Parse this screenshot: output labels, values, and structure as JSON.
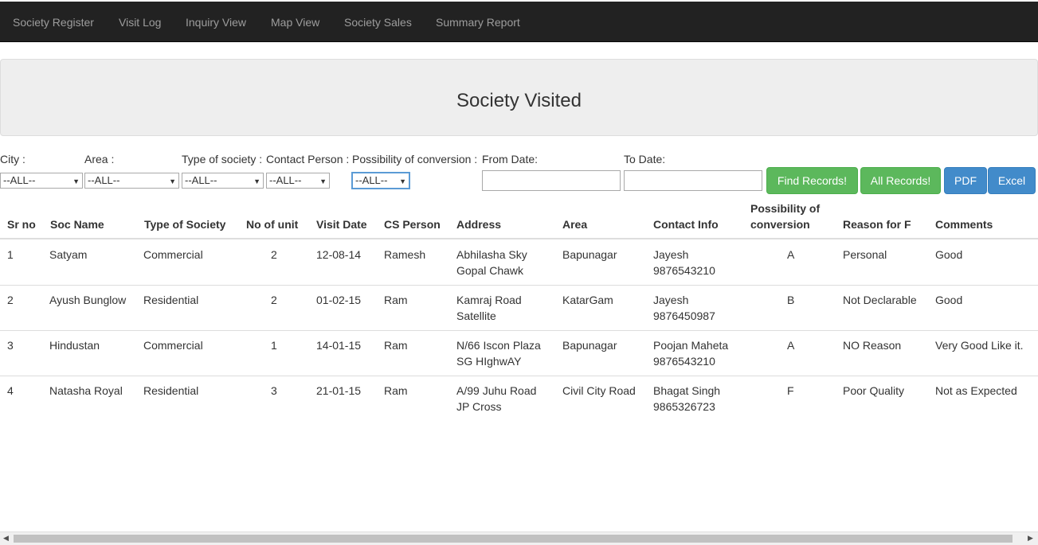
{
  "nav": {
    "items": [
      "Society Register",
      "Visit Log",
      "Inquiry View",
      "Map View",
      "Society Sales",
      "Summary Report"
    ]
  },
  "page": {
    "title": "Society Visited"
  },
  "filters": {
    "city_label": "City :",
    "area_label": "Area :",
    "type_label": "Type of society :",
    "contact_label": "Contact Person :",
    "possibility_label": "Possibility of conversion :",
    "from_label": "From Date:",
    "to_label": "To Date:",
    "city_value": "--ALL--",
    "area_value": "--ALL--",
    "type_value": "--ALL--",
    "contact_value": "--ALL--",
    "possibility_value": "--ALL--",
    "from_value": "",
    "to_value": ""
  },
  "buttons": {
    "find": "Find Records!",
    "all": "All Records!",
    "pdf": "PDF",
    "excel": "Excel"
  },
  "table": {
    "headers": {
      "sr": "Sr no",
      "soc": "Soc Name",
      "type": "Type of Society",
      "units": "No of unit",
      "date": "Visit Date",
      "cs": "CS Person",
      "address": "Address",
      "area": "Area",
      "contact": "Contact Info",
      "possibility_1": "Possibility of",
      "possibility_2": "conversion",
      "reason": "Reason for F",
      "comments": "Comments"
    },
    "rows": [
      {
        "sr": "1",
        "soc": "Satyam",
        "type": "Commercial",
        "units": "2",
        "date": "12-08-14",
        "cs": "Ramesh",
        "address_1": "Abhilasha Sky",
        "address_2": "Gopal Chawk",
        "area": "Bapunagar",
        "contact_1": "Jayesh",
        "contact_2": "9876543210",
        "possibility": "A",
        "reason": "Personal",
        "comments": "Good"
      },
      {
        "sr": "2",
        "soc": "Ayush Bunglow",
        "type": "Residential",
        "units": "2",
        "date": "01-02-15",
        "cs": "Ram",
        "address_1": "Kamraj Road",
        "address_2": "Satellite",
        "area": "KatarGam",
        "contact_1": "Jayesh",
        "contact_2": "9876450987",
        "possibility": "B",
        "reason": "Not Declarable",
        "comments": "Good"
      },
      {
        "sr": "3",
        "soc": "Hindustan",
        "type": "Commercial",
        "units": "1",
        "date": "14-01-15",
        "cs": "Ram",
        "address_1": "N/66 Iscon Plaza",
        "address_2": "SG HIghwAY",
        "area": "Bapunagar",
        "contact_1": "Poojan Maheta",
        "contact_2": "9876543210",
        "possibility": "A",
        "reason": "NO Reason",
        "comments": "Very Good Like it."
      },
      {
        "sr": "4",
        "soc": "Natasha Royal",
        "type": "Residential",
        "units": "3",
        "date": "21-01-15",
        "cs": "Ram",
        "address_1": "A/99 Juhu Road",
        "address_2": "JP Cross",
        "area": "Civil City Road",
        "contact_1": "Bhagat Singh",
        "contact_2": "9865326723",
        "possibility": "F",
        "reason": "Poor Quality",
        "comments": "Not as Expected"
      }
    ]
  },
  "icons": {
    "select_arrow": "caret-down-icon",
    "scroll_left": "scroll-left-icon",
    "scroll_right": "scroll-right-icon"
  }
}
